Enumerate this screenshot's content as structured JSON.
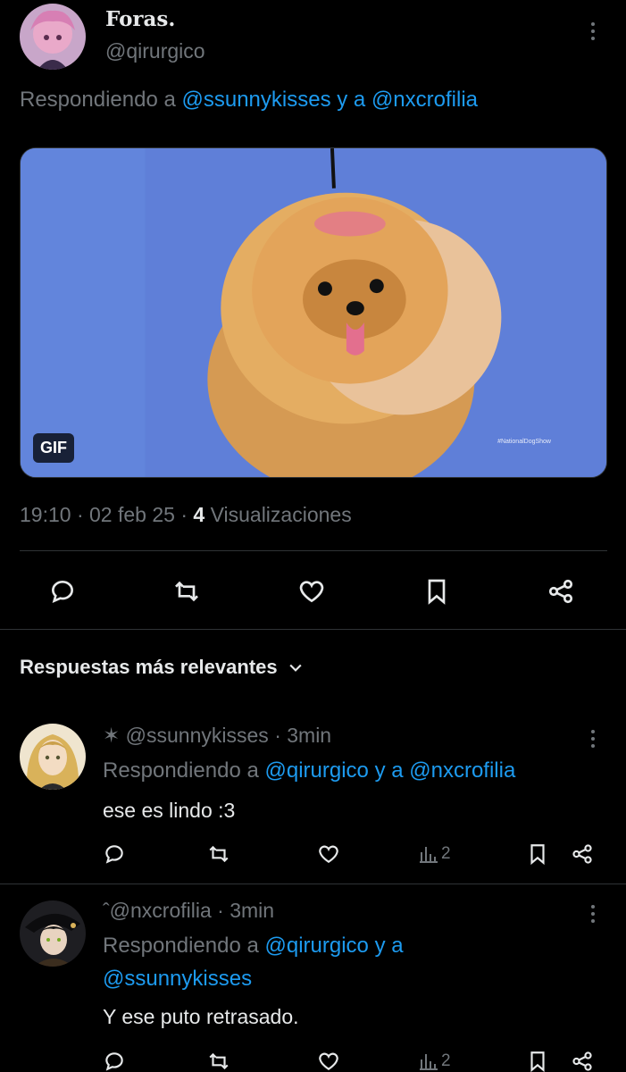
{
  "tweet": {
    "display_name": "Foras.",
    "handle": "@qirurgico",
    "replying_prefix": "Respondiendo a",
    "replying_mention1": "@ssunnykisses",
    "replying_joiner": "y a",
    "replying_mention2": "@nxcrofilia",
    "gif_badge": "GIF",
    "media_watermark": "#NationalDogShow",
    "time": "19:10",
    "date": "02 feb 25",
    "views_count": "4",
    "views_label": "Visualizaciones",
    "actions": [
      "reply-icon",
      "retweet-icon",
      "like-icon",
      "bookmark-icon",
      "share-icon"
    ]
  },
  "sort": {
    "label": "Respuestas más relevantes",
    "icon": "chevron-down-icon"
  },
  "replies": [
    {
      "handle": "✶ @ssunnykisses",
      "time": "· 3min",
      "replying_prefix": "Respondiendo a",
      "replying_mention1": "@qirurgico",
      "replying_joiner": "y a",
      "replying_mention2": "@nxcrofilia",
      "text": "ese es lindo :3",
      "views": "2"
    },
    {
      "handle": "ˆ@nxcrofilia",
      "time": "· 3min",
      "replying_prefix": "Respondiendo a",
      "replying_mention1": "@qirurgico",
      "replying_joiner": "y a",
      "replying_mention2": "@ssunnykisses",
      "text": "Y ese puto retrasado.",
      "views": "2"
    }
  ],
  "colors": {
    "background": "#000000",
    "text_primary": "#e7e9ea",
    "text_secondary": "#71767b",
    "link": "#1d9bf0",
    "divider": "#2f3336",
    "media_bg": "#5f7fd8"
  }
}
